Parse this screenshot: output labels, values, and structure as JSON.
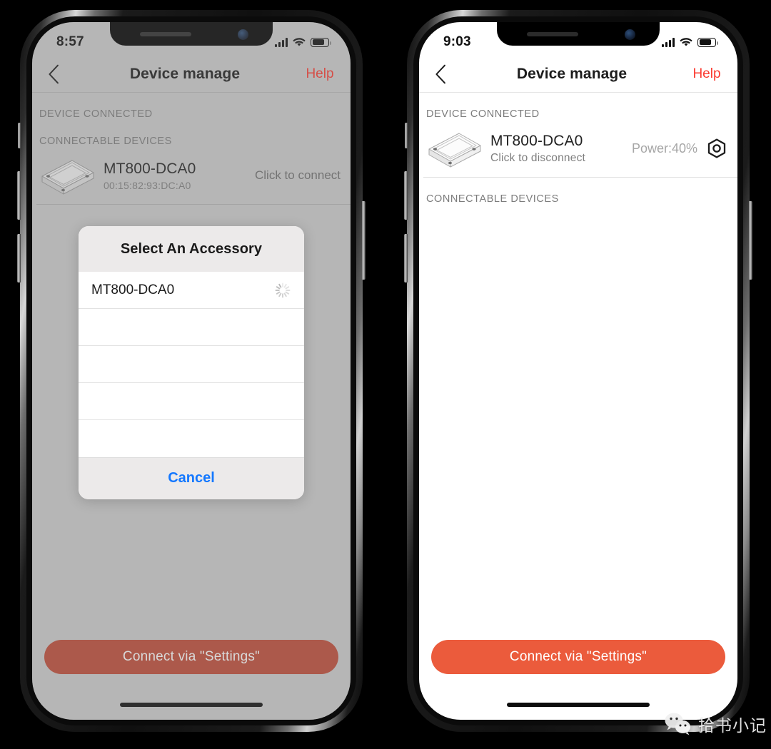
{
  "left_phone": {
    "status_bar": {
      "time": "8:57",
      "signal_icon": "cellular-bars-icon",
      "wifi_icon": "wifi-icon",
      "battery_icon": "battery-icon"
    },
    "nav": {
      "back_icon": "chevron-left-icon",
      "title": "Device manage",
      "help_label": "Help"
    },
    "sections": {
      "connected_header": "DEVICE CONNECTED",
      "connectable_header": "CONNECTABLE DEVICES"
    },
    "connectable_device": {
      "image_icon": "scanner-bar-device-image",
      "name": "MT800-DCA0",
      "mac": "00:15:82:93:DC:A0",
      "action": "Click to connect"
    },
    "modal": {
      "title": "Select An Accessory",
      "items": [
        "MT800-DCA0"
      ],
      "blank_rows": 4,
      "spinner_icon": "loading-spinner-icon",
      "cancel_label": "Cancel",
      "cancel_color": "#1478ff"
    },
    "cta": {
      "label": "Connect via \"Settings\"",
      "color": "#c04a35"
    }
  },
  "right_phone": {
    "status_bar": {
      "time": "9:03",
      "signal_icon": "cellular-bars-icon",
      "wifi_icon": "wifi-icon",
      "battery_icon": "battery-icon"
    },
    "nav": {
      "back_icon": "chevron-left-icon",
      "title": "Device manage",
      "help_label": "Help"
    },
    "sections": {
      "connected_header": "DEVICE CONNECTED",
      "connectable_header": "CONNECTABLE DEVICES"
    },
    "connected_device": {
      "image_icon": "scanner-bar-device-image",
      "name": "MT800-DCA0",
      "action": "Click to disconnect",
      "power": "Power:40%",
      "settings_icon": "hex-nut-settings-icon"
    },
    "cta": {
      "label": "Connect via \"Settings\"",
      "color": "#eb5b3c"
    }
  },
  "watermark": {
    "logo_icon": "wechat-logo-icon",
    "text": "拾书小记"
  }
}
